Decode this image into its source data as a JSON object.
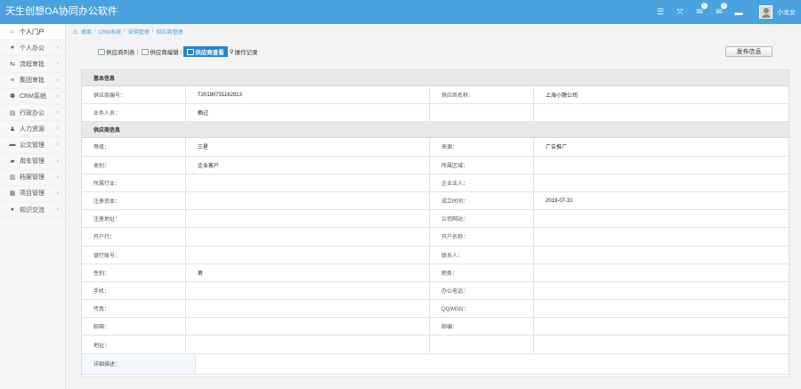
{
  "app": {
    "title": "天生创想OA协同办公软件"
  },
  "header": {
    "icons": [
      {
        "name": "menu-icon",
        "glyph": "☰"
      },
      {
        "name": "fullscreen-icon",
        "glyph": "⤧"
      },
      {
        "name": "chat-icon",
        "glyph": "✉",
        "badge": "0"
      },
      {
        "name": "message-icon",
        "glyph": "✉",
        "badge": "0"
      },
      {
        "name": "comment-icon",
        "glyph": "▬"
      }
    ],
    "user_name": "小龙女"
  },
  "sidebar": {
    "items": [
      {
        "label": "个人门户",
        "icon": "home-icon",
        "glyph": "⌂",
        "active": true
      },
      {
        "label": "个人办公",
        "icon": "user-icon",
        "glyph": "●"
      },
      {
        "label": "流程审批",
        "icon": "flow-icon",
        "glyph": "⇆"
      },
      {
        "label": "集团审批",
        "icon": "list-icon",
        "glyph": "≡"
      },
      {
        "label": "CRM系统",
        "icon": "users-icon",
        "glyph": "⚉"
      },
      {
        "label": "行政办公",
        "icon": "briefcase-icon",
        "glyph": "▤"
      },
      {
        "label": "人力资源",
        "icon": "person-icon",
        "glyph": "♟"
      },
      {
        "label": "公文管理",
        "icon": "folder-icon",
        "glyph": "▬"
      },
      {
        "label": "用车管理",
        "icon": "car-icon",
        "glyph": "▰"
      },
      {
        "label": "档案管理",
        "icon": "archive-icon",
        "glyph": "▥"
      },
      {
        "label": "项目管理",
        "icon": "project-icon",
        "glyph": "▦"
      },
      {
        "label": "知识交流",
        "icon": "knowledge-icon",
        "glyph": "●"
      }
    ]
  },
  "breadcrumb": [
    "桌面",
    "CRM系统",
    "采购管理",
    "供应商管理"
  ],
  "tabs": [
    {
      "label": "供应商列表",
      "active": false
    },
    {
      "label": "供应商编辑",
      "active": false
    },
    {
      "label": "供应商查看",
      "active": true
    },
    {
      "label": "操作记录",
      "active": false
    }
  ],
  "publish_label": "发布信息",
  "sections": {
    "basic": {
      "title": "基本信息",
      "rows": [
        [
          "供应商编号：",
          "T20190731162913",
          "供应商名称：",
          "上海小憩公司"
        ],
        [
          "业务人员：",
          "赖过",
          "",
          ""
        ]
      ]
    },
    "supplier": {
      "title": "供应商信息",
      "rows": [
        [
          "等级：",
          "三星",
          "来源：",
          "广告推广"
        ],
        [
          "类别：",
          "企业客户",
          "所属区域：",
          ""
        ],
        [
          "所属行业：",
          "",
          "企业法人：",
          ""
        ],
        [
          "注册资本：",
          "",
          "成立时间：",
          "2019-07-31"
        ],
        [
          "注册地址：",
          "",
          "公司网站：",
          ""
        ],
        [
          "开户行：",
          "",
          "开户名称：",
          ""
        ],
        [
          "银行账号：",
          "",
          "联系人：",
          ""
        ],
        [
          "性别：",
          "男",
          "职务：",
          ""
        ],
        [
          "手机：",
          "",
          "办公电话：",
          ""
        ],
        [
          "传真：",
          "",
          "QQ/MSN：",
          ""
        ],
        [
          "邮箱：",
          "",
          "邮编：",
          ""
        ],
        [
          "地址：",
          "",
          "",
          ""
        ]
      ],
      "detail_label": "详细描述：",
      "detail_value": ""
    }
  }
}
